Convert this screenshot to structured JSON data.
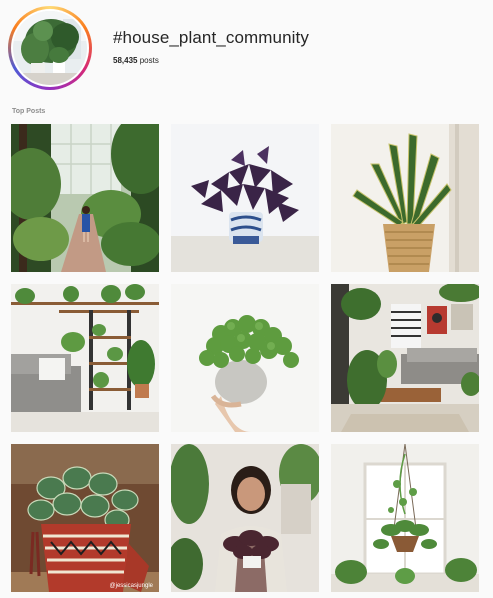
{
  "hashtag": {
    "title": "#house_plant_community",
    "post_count": "58,435",
    "post_label": "posts"
  },
  "top_posts": {
    "section_label": "Top Posts",
    "posts": [
      {
        "name": "post-greenhouse-woman"
      },
      {
        "name": "post-purple-oxalis"
      },
      {
        "name": "post-snake-plant-basket"
      },
      {
        "name": "post-shelf-living-room"
      },
      {
        "name": "post-hand-held-succulent"
      },
      {
        "name": "post-boho-living-room"
      },
      {
        "name": "post-watermelon-peperomia",
        "watermark": "@jessicasjungle"
      },
      {
        "name": "post-woman-holding-plant"
      },
      {
        "name": "post-hanging-planter-window"
      }
    ]
  }
}
